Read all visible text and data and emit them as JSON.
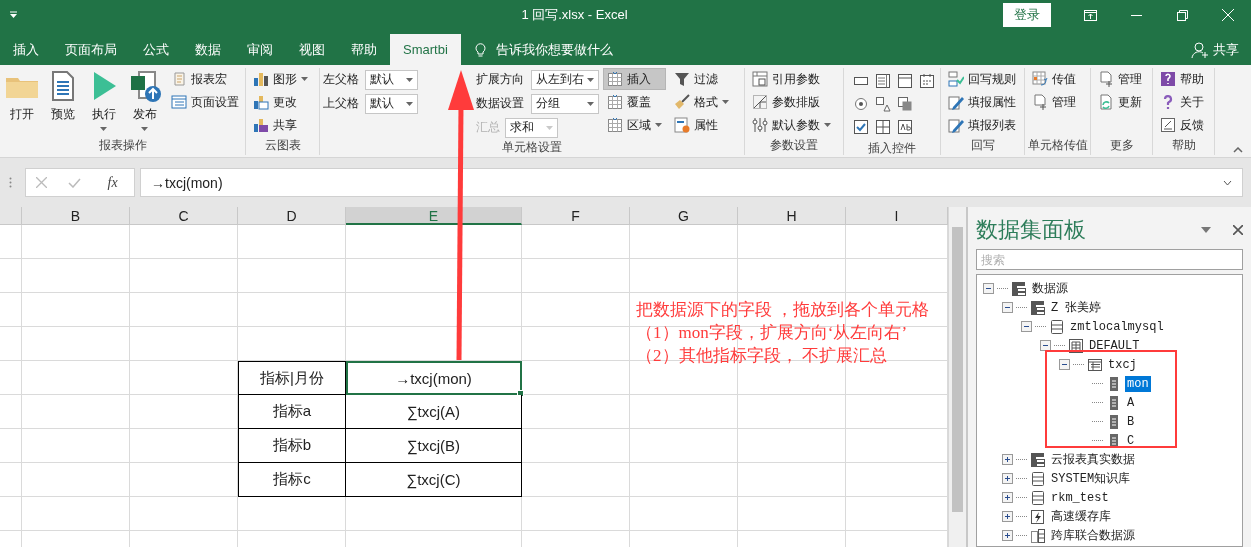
{
  "window": {
    "title": "1 回写.xlsx - Excel",
    "login_button": "登录"
  },
  "tabs": [
    {
      "label": "插入",
      "selected": false
    },
    {
      "label": "页面布局",
      "selected": false
    },
    {
      "label": "公式",
      "selected": false
    },
    {
      "label": "数据",
      "selected": false
    },
    {
      "label": "审阅",
      "selected": false
    },
    {
      "label": "视图",
      "selected": false
    },
    {
      "label": "帮助",
      "selected": false
    },
    {
      "label": "Smartbi",
      "selected": true
    }
  ],
  "tell_me": "告诉我你想要做什么",
  "share_button": "共享",
  "ribbon_groups": [
    {
      "label": "报表操作",
      "kind": "buttons",
      "columns": [
        [
          {
            "kind": "large",
            "label": "打开",
            "dropdown": false
          }
        ],
        [
          {
            "kind": "large",
            "label": "预览",
            "dropdown": false
          }
        ],
        [
          {
            "kind": "large",
            "label": "执行",
            "dropdown": true
          }
        ],
        [
          {
            "kind": "large",
            "label": "发布",
            "dropdown": true
          }
        ],
        [
          {
            "kind": "small",
            "label": "报表宏",
            "dropdown": false
          },
          {
            "kind": "small",
            "label": "页面设置",
            "dropdown": false
          }
        ]
      ]
    },
    {
      "label": "云图表",
      "kind": "buttons",
      "columns": [
        [
          {
            "kind": "small",
            "label": "图形",
            "dropdown": true
          },
          {
            "kind": "small",
            "label": "更改",
            "dropdown": false
          },
          {
            "kind": "small",
            "label": "共享",
            "dropdown": false
          }
        ]
      ]
    },
    {
      "label": "单元格设置",
      "kind": "buttons",
      "columns": [
        [
          {
            "kind": "field",
            "label": "左父格",
            "value": "默认",
            "disabled": false
          },
          {
            "kind": "field",
            "label": "上父格",
            "value": "默认",
            "disabled": false
          }
        ],
        [
          {
            "kind": "field",
            "label": "扩展方向",
            "value": "从左到右",
            "disabled": false
          },
          {
            "kind": "field",
            "label": "数据设置",
            "value": "分组",
            "disabled": false
          },
          {
            "kind": "field",
            "label": "汇总",
            "value": "求和",
            "disabled": true
          }
        ],
        [
          {
            "kind": "small",
            "label": "插入",
            "dropdown": false,
            "selected": true
          },
          {
            "kind": "small",
            "label": "覆盖",
            "dropdown": false,
            "selected": false
          },
          {
            "kind": "small",
            "label": "区域",
            "dropdown": true,
            "selected": false
          }
        ],
        [
          {
            "kind": "small",
            "label": "过滤",
            "dropdown": false
          },
          {
            "kind": "small",
            "label": "格式",
            "dropdown": true
          },
          {
            "kind": "small",
            "label": "属性",
            "dropdown": false
          }
        ]
      ]
    },
    {
      "label": "参数设置",
      "kind": "buttons",
      "columns": [
        [
          {
            "kind": "small",
            "label": "引用参数",
            "dropdown": false
          },
          {
            "kind": "small",
            "label": "参数排版",
            "dropdown": false
          },
          {
            "kind": "small",
            "label": "默认参数",
            "dropdown": true
          }
        ]
      ]
    },
    {
      "label": "插入控件",
      "kind": "icon_grid"
    },
    {
      "label": "回写",
      "kind": "buttons",
      "columns": [
        [
          {
            "kind": "small",
            "label": "回写规则",
            "dropdown": false
          },
          {
            "kind": "small",
            "label": "填报属性",
            "dropdown": false
          },
          {
            "kind": "small",
            "label": "填报列表",
            "dropdown": false
          }
        ]
      ]
    },
    {
      "label": "单元格传值",
      "kind": "buttons",
      "columns": [
        [
          {
            "kind": "small",
            "label": "传值",
            "dropdown": false
          },
          {
            "kind": "small",
            "label": "管理",
            "dropdown": false
          }
        ]
      ]
    },
    {
      "label": "更多",
      "kind": "buttons",
      "columns": [
        [
          {
            "kind": "small",
            "label": "管理",
            "dropdown": false
          },
          {
            "kind": "small",
            "label": "更新",
            "dropdown": false
          }
        ]
      ]
    },
    {
      "label": "帮助",
      "kind": "buttons",
      "columns": [
        [
          {
            "kind": "small",
            "label": "帮助",
            "dropdown": false
          },
          {
            "kind": "small",
            "label": "关于",
            "dropdown": false
          },
          {
            "kind": "small",
            "label": "反馈",
            "dropdown": false
          }
        ]
      ]
    }
  ],
  "formula_bar": {
    "function_label": "fx",
    "value": "→txcj(mon)"
  },
  "columns": [
    {
      "label": "B",
      "selected": false
    },
    {
      "label": "C",
      "selected": false
    },
    {
      "label": "D",
      "selected": false
    },
    {
      "label": "E",
      "selected": true
    },
    {
      "label": "F",
      "selected": false
    },
    {
      "label": "G",
      "selected": false
    },
    {
      "label": "H",
      "selected": false
    },
    {
      "label": "I",
      "selected": false
    }
  ],
  "table": {
    "rows": [
      [
        {
          "text": "指标|月份",
          "selected": false
        },
        {
          "text": "→txcj(mon)",
          "selected": true
        }
      ],
      [
        {
          "text": "指标a",
          "selected": false
        },
        {
          "text": "∑txcj(A)",
          "selected": false
        }
      ],
      [
        {
          "text": "指标b",
          "selected": false
        },
        {
          "text": "∑txcj(B)",
          "selected": false
        }
      ],
      [
        {
          "text": "指标c",
          "selected": false
        },
        {
          "text": "∑txcj(C)",
          "selected": false
        }
      ]
    ]
  },
  "annotation": {
    "lines": [
      "把数据源下的字段 ，拖放到各个单元格",
      "（1）mon字段，扩展方向‘从左向右’",
      "（2）其他指标字段， 不扩展汇总"
    ]
  },
  "panel": {
    "title": "数据集面板",
    "search": {
      "placeholder": "搜索"
    },
    "tree": [
      {
        "label": "数据源",
        "kind": "source",
        "expanded": true,
        "selected": false,
        "children": [
          {
            "label": "Z 张美婷",
            "kind": "source",
            "expanded": true,
            "selected": false,
            "children": [
              {
                "label": "zmtlocalmysql",
                "kind": "database",
                "expanded": true,
                "selected": false,
                "children": [
                  {
                    "label": "DEFAULT",
                    "kind": "schema",
                    "expanded": true,
                    "selected": false,
                    "children": [
                      {
                        "label": "txcj",
                        "kind": "table",
                        "expanded": true,
                        "selected": false,
                        "children": [
                          {
                            "label": "mon",
                            "kind": "field",
                            "selected": true
                          },
                          {
                            "label": "A",
                            "kind": "field",
                            "selected": false
                          },
                          {
                            "label": "B",
                            "kind": "field",
                            "selected": false
                          },
                          {
                            "label": "C",
                            "kind": "field",
                            "selected": false
                          }
                        ]
                      }
                    ]
                  }
                ]
              }
            ]
          },
          {
            "label": "云报表真实数据",
            "kind": "source",
            "expanded": false,
            "selected": false
          },
          {
            "label": "SYSTEM知识库",
            "kind": "database",
            "expanded": false,
            "selected": false
          },
          {
            "label": "rkm_test",
            "kind": "database",
            "expanded": false,
            "selected": false
          },
          {
            "label": "高速缓存库",
            "kind": "cache",
            "expanded": false,
            "selected": false
          },
          {
            "label": "跨库联合数据源",
            "kind": "federated",
            "expanded": false,
            "selected": false
          }
        ]
      }
    ]
  }
}
